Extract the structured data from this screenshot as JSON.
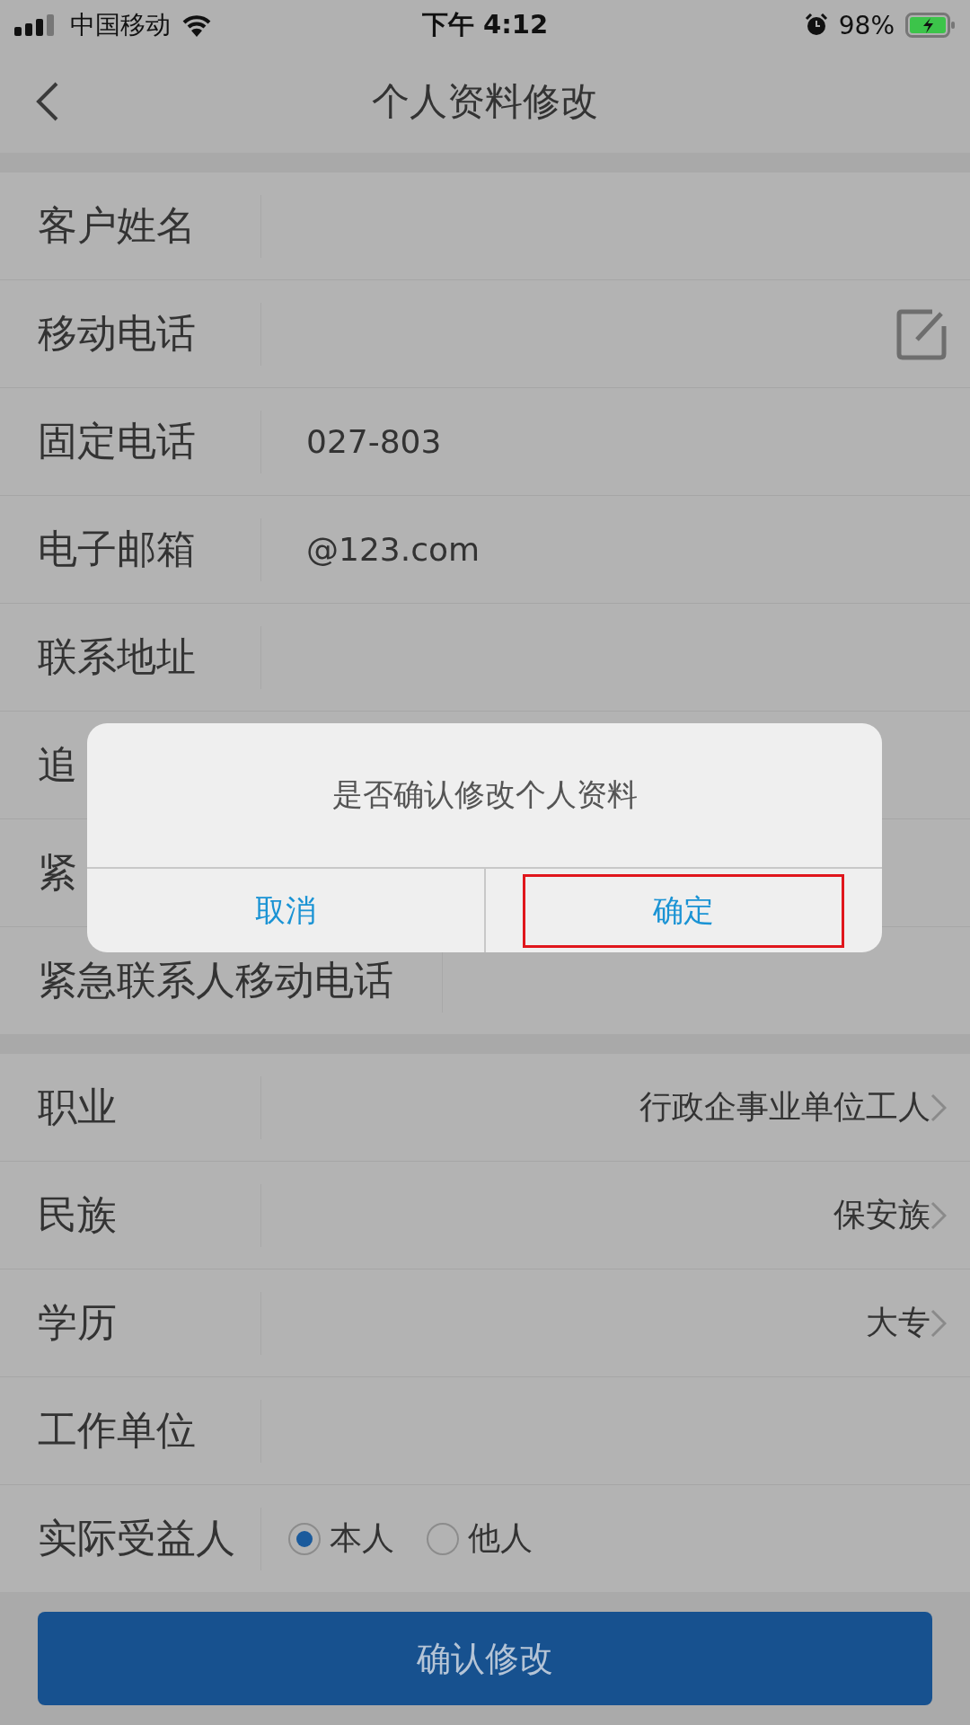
{
  "status_bar": {
    "carrier": "中国移动",
    "time": "下午 4:12",
    "battery": "98%"
  },
  "nav": {
    "title": "个人资料修改"
  },
  "sections": [
    {
      "rows": [
        {
          "kind": "text",
          "label": "客户姓名"
        },
        {
          "kind": "edit",
          "label": "移动电话"
        },
        {
          "kind": "text",
          "label": "固定电话",
          "value": "027-803"
        },
        {
          "kind": "text",
          "label": "电子邮箱",
          "value": "@123.com"
        },
        {
          "kind": "text",
          "label": "联系地址"
        },
        {
          "kind": "covered",
          "label": "追"
        },
        {
          "kind": "covered",
          "label": "紧"
        },
        {
          "kind": "text",
          "label": "紧急联系人移动电话"
        }
      ]
    },
    {
      "rows": [
        {
          "kind": "select",
          "label": "职业",
          "value": "行政企事业单位工人"
        },
        {
          "kind": "select",
          "label": "民族",
          "value": "保安族"
        },
        {
          "kind": "select",
          "label": "学历",
          "value": "大专"
        },
        {
          "kind": "text",
          "label": "工作单位"
        },
        {
          "kind": "radio",
          "label": "实际受益人",
          "options": [
            {
              "label": "本人",
              "selected": true
            },
            {
              "label": "他人",
              "selected": false
            }
          ]
        }
      ]
    }
  ],
  "submit": "确认修改",
  "dialog": {
    "message": "是否确认修改个人资料",
    "buttons": [
      {
        "label": "取消",
        "outlined": false
      },
      {
        "label": "确定",
        "outlined": true
      }
    ]
  }
}
